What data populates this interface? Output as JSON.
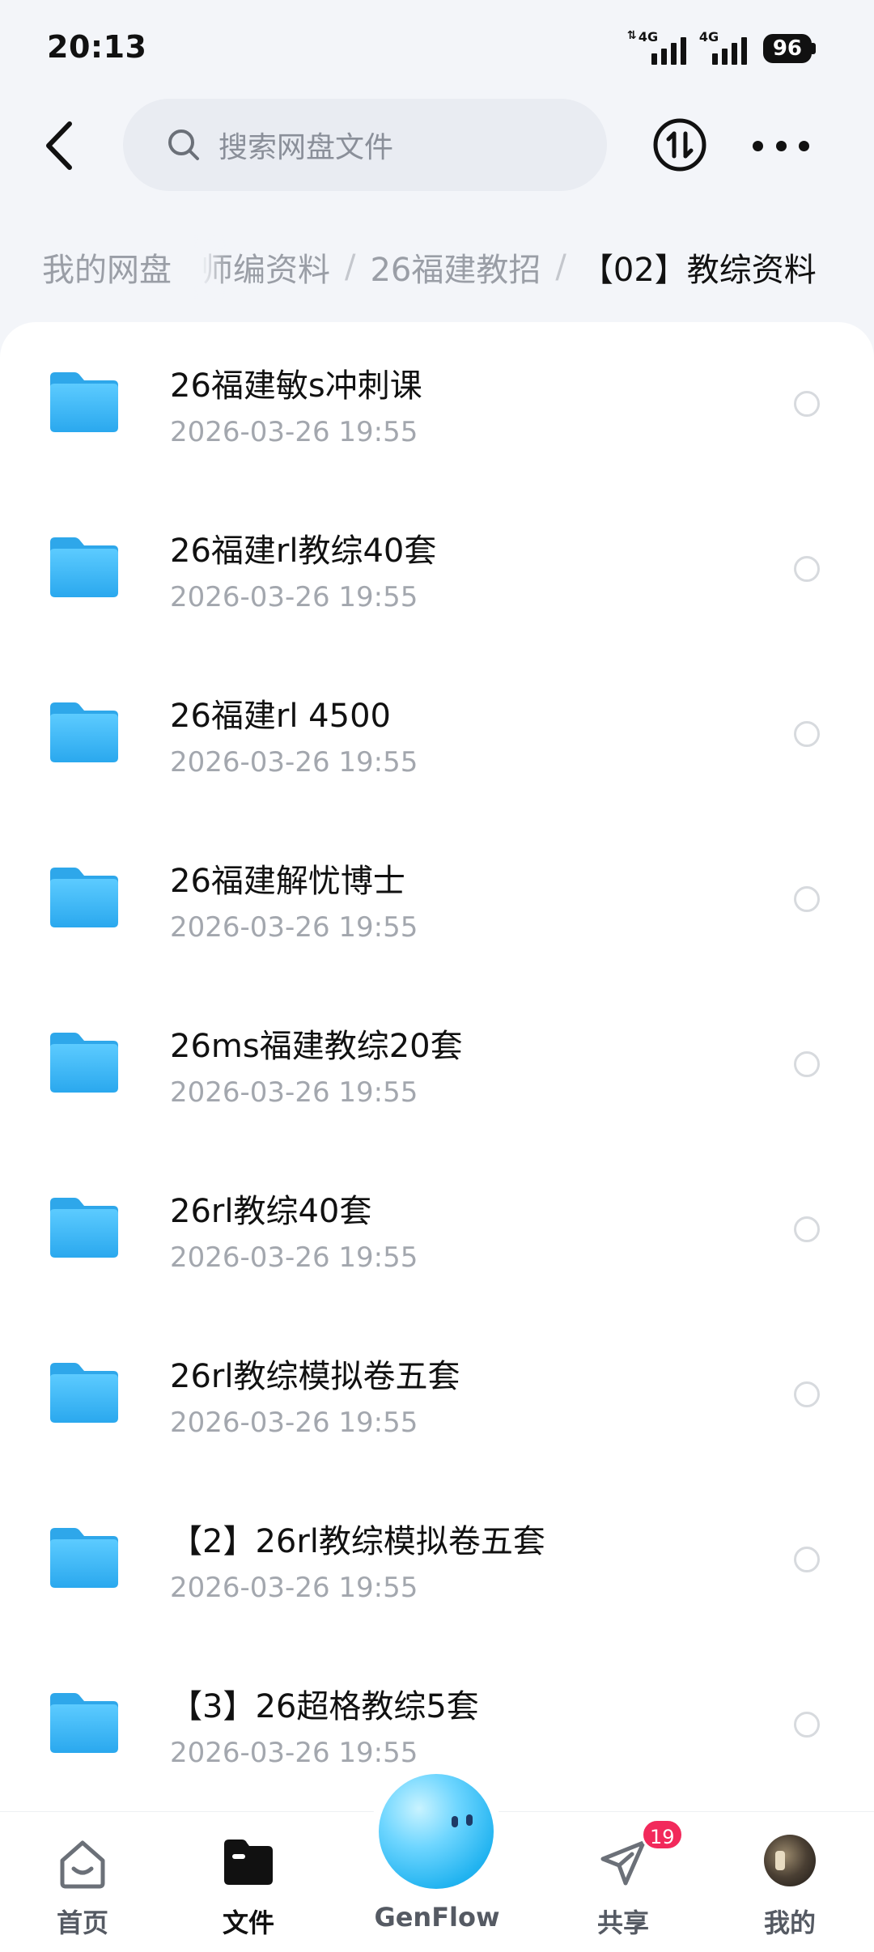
{
  "status_bar": {
    "time": "20:13",
    "network1": "4G",
    "network2": "4G",
    "battery": "96"
  },
  "header": {
    "search_placeholder": "搜索网盘文件"
  },
  "breadcrumb": {
    "root": "我的网盘",
    "trail": [
      "师编资料",
      "26福建教招"
    ],
    "separator": "/",
    "current": "【02】教综资料"
  },
  "files": [
    {
      "name": "26福建敏s冲刺课",
      "date": "2026-03-26  19:55"
    },
    {
      "name": "26福建rl教综40套",
      "date": "2026-03-26  19:55"
    },
    {
      "name": "26福建rl 4500",
      "date": "2026-03-26  19:55"
    },
    {
      "name": "26福建解忧博士",
      "date": "2026-03-26  19:55"
    },
    {
      "name": "26ms福建教综20套",
      "date": "2026-03-26  19:55"
    },
    {
      "name": "26rl教综40套",
      "date": "2026-03-26  19:55"
    },
    {
      "name": "26rl教综模拟卷五套",
      "date": "2026-03-26  19:55"
    },
    {
      "name": "【2】26rl教综模拟卷五套",
      "date": "2026-03-26  19:55"
    },
    {
      "name": "【3】26超格教综5套",
      "date": "2026-03-26  19:55"
    }
  ],
  "bottom_nav": {
    "home": "首页",
    "files": "文件",
    "genflow": "GenFlow",
    "share": "共享",
    "share_badge": "19",
    "mine": "我的"
  },
  "colors": {
    "folder": "#3bb7f5",
    "badge": "#f2295b",
    "background": "#f3f5f9"
  }
}
